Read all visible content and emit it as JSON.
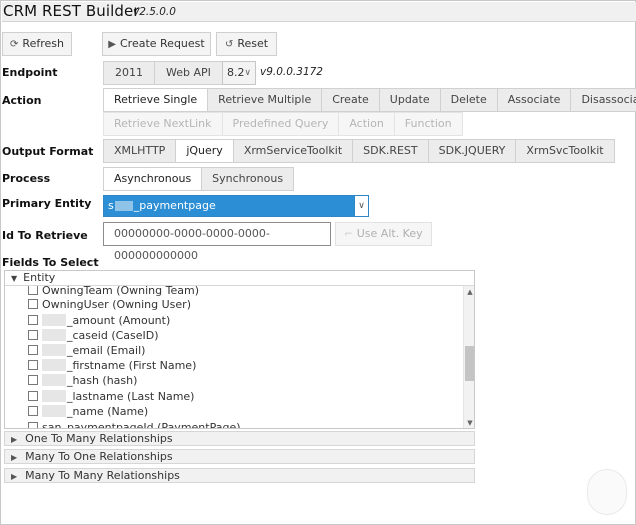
{
  "app": {
    "title": "CRM REST Builder",
    "version": "v2.5.0.0"
  },
  "toolbar": {
    "refresh": "Refresh",
    "create_request": "Create Request",
    "reset": "Reset"
  },
  "endpoint": {
    "label": "Endpoint",
    "options": [
      "2011",
      "Web API"
    ],
    "selected": "Web API",
    "version_select": "8.2",
    "api_version": "v9.0.0.3172"
  },
  "action": {
    "label": "Action",
    "row1": [
      "Retrieve Single",
      "Retrieve Multiple",
      "Create",
      "Update",
      "Delete",
      "Associate",
      "Disassociate"
    ],
    "selected": "Retrieve Single",
    "row2": [
      "Retrieve NextLink",
      "Predefined Query",
      "Action",
      "Function"
    ]
  },
  "output_format": {
    "label": "Output Format",
    "options": [
      "XMLHTTP",
      "jQuery",
      "XrmServiceToolkit",
      "SDK.REST",
      "SDK.JQUERY",
      "XrmSvcToolkit"
    ],
    "selected": "jQuery"
  },
  "process": {
    "label": "Process",
    "options": [
      "Asynchronous",
      "Synchronous"
    ],
    "selected": "Asynchronous"
  },
  "primary_entity": {
    "label": "Primary Entity",
    "value_prefix": "s",
    "value_suffix": "_paymentpage"
  },
  "id_to_retrieve": {
    "label": "Id To Retrieve",
    "value": "00000000-0000-0000-0000-000000000000",
    "alt_key": "Use Alt. Key"
  },
  "fields": {
    "label": "Fields To Select",
    "section": "Entity",
    "items": [
      "OwningTeam (Owning Team)",
      "OwningUser (Owning User)",
      "_amount (Amount)",
      "_caseid (CaseID)",
      "_email (Email)",
      "_firstname (First Name)",
      "_hash (hash)",
      "_lastname (Last Name)",
      "_name (Name)",
      "san_paymentpageId (PaymentPage)"
    ]
  },
  "relationships": [
    "One To Many Relationships",
    "Many To One Relationships",
    "Many To Many Relationships"
  ],
  "icons": {
    "refresh": "refresh-icon",
    "create": "play-icon",
    "reset": "reset-icon",
    "alt_key": "key-icon"
  }
}
